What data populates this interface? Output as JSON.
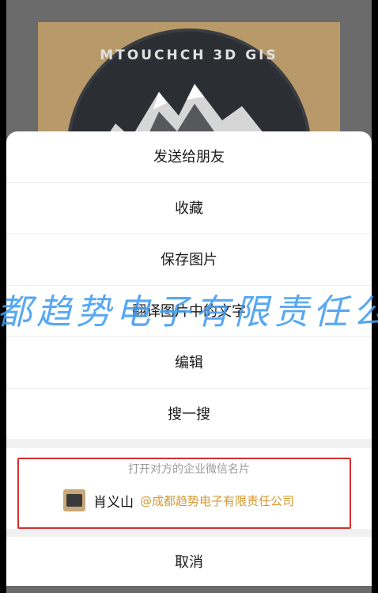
{
  "background_image": {
    "badge_text": "MTOUCHCH 3D GIS"
  },
  "action_sheet": {
    "items": [
      {
        "label": "发送给朋友"
      },
      {
        "label": "收藏"
      },
      {
        "label": "保存图片"
      },
      {
        "label": "翻译图片中的文字"
      },
      {
        "label": "编辑"
      },
      {
        "label": "搜一搜"
      }
    ],
    "card": {
      "title": "打开对方的企业微信名片",
      "name": "肖义山",
      "company": "@成都趋势电子有限责任公司"
    },
    "cancel_label": "取消"
  },
  "watermark_text": "都趋势电子有限责任公",
  "colors": {
    "highlight_border": "#d32f2f",
    "company_text": "#d79a32",
    "watermark": "#409cf0"
  }
}
